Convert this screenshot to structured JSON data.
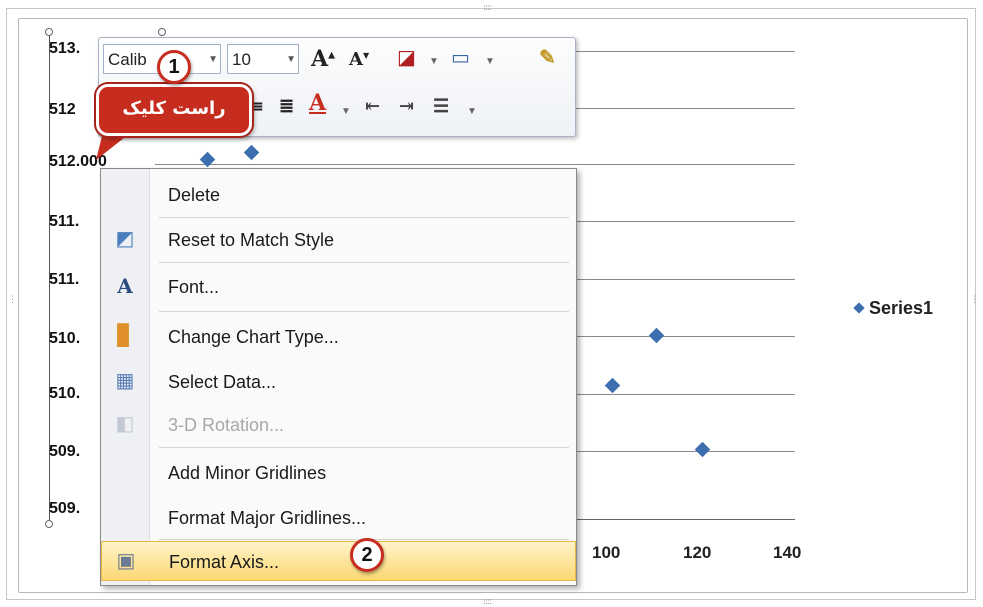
{
  "chart_data": {
    "type": "scatter",
    "y_tick_labels": [
      "513.",
      "512",
      "512.000",
      "511.",
      "511.",
      "510.",
      "510.",
      "509.",
      "509."
    ],
    "x_tick_labels": [
      "100",
      "120",
      "140"
    ],
    "legend": [
      "Series1"
    ],
    "series": [
      {
        "name": "Series1",
        "points": [
          {
            "x": 100,
            "y": 510.1
          },
          {
            "x": 110,
            "y": 510.5
          },
          {
            "x": 120,
            "y": 509.6
          }
        ]
      }
    ],
    "grid": true,
    "legend_position": "right"
  },
  "mini_toolbar": {
    "font_name": "Calib",
    "font_size": "10",
    "grow_font": "A",
    "shrink_font": "A",
    "font_color": "A"
  },
  "callouts": {
    "right_click_label": "راست کلیک",
    "step1": "1",
    "step2": "2"
  },
  "context_menu": {
    "items": [
      {
        "label": "Delete",
        "icon": "none",
        "enabled": true
      },
      {
        "label": "Reset to Match Style",
        "icon": "reset-style-icon",
        "enabled": true
      },
      {
        "label": "Font...",
        "icon": "font-icon",
        "enabled": true
      },
      {
        "label": "Change Chart Type...",
        "icon": "chart-type-icon",
        "enabled": true
      },
      {
        "label": "Select Data...",
        "icon": "select-data-icon",
        "enabled": true
      },
      {
        "label": "3-D Rotation...",
        "icon": "3d-rotation-icon",
        "enabled": false
      },
      {
        "label": "Add Minor Gridlines",
        "icon": "none",
        "enabled": true
      },
      {
        "label": "Format Major Gridlines...",
        "icon": "none",
        "enabled": true
      },
      {
        "label": "Format Axis...",
        "icon": "format-axis-icon",
        "enabled": true,
        "highlighted": true
      }
    ]
  },
  "colors": {
    "series": "#3d6fb0",
    "callout": "#c62d1f",
    "highlight": "#fbd873"
  }
}
